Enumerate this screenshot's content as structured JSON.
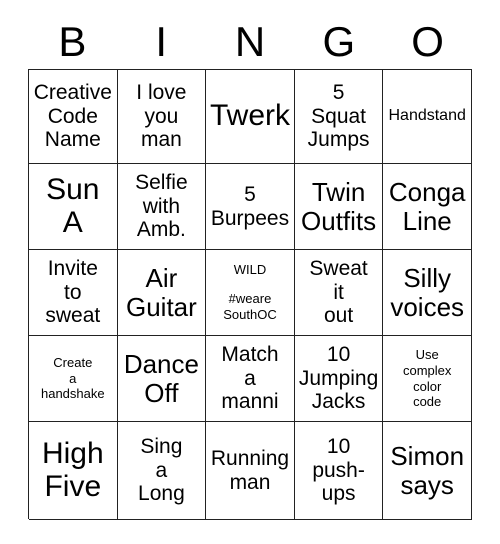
{
  "card": {
    "title_letters": [
      "B",
      "I",
      "N",
      "G",
      "O"
    ],
    "rows": [
      [
        {
          "text": "Creative\nCode\nName",
          "size": "fs-md"
        },
        {
          "text": "I love\nyou\nman",
          "size": "fs-md"
        },
        {
          "text": "Twerk",
          "size": "fs-xl"
        },
        {
          "text": "5\nSquat\nJumps",
          "size": "fs-md"
        },
        {
          "text": "Handstand",
          "size": "fs-sm"
        }
      ],
      [
        {
          "text": "Sun\nA",
          "size": "fs-xl"
        },
        {
          "text": "Selfie\nwith\nAmb.",
          "size": "fs-md"
        },
        {
          "text": "5\nBurpees",
          "size": "fs-md"
        },
        {
          "text": "Twin\nOutfits",
          "size": "fs-lg"
        },
        {
          "text": "Conga\nLine",
          "size": "fs-lg"
        }
      ],
      [
        {
          "text": "Invite\nto\nsweat",
          "size": "fs-md"
        },
        {
          "text": "Air\nGuitar",
          "size": "fs-lg"
        },
        {
          "text": "WILD",
          "tag": "#weare\nSouthOC",
          "size": "wild"
        },
        {
          "text": "Sweat\nit\nout",
          "size": "fs-md"
        },
        {
          "text": "Silly\nvoices",
          "size": "fs-lg"
        }
      ],
      [
        {
          "text": "Create\na\nhandshake",
          "size": "fs-xs"
        },
        {
          "text": "Dance\nOff",
          "size": "fs-lg"
        },
        {
          "text": "Match\na\nmanni",
          "size": "fs-md"
        },
        {
          "text": "10\nJumping\nJacks",
          "size": "fs-md"
        },
        {
          "text": "Use\ncomplex\ncolor\ncode",
          "size": "fs-xs"
        }
      ],
      [
        {
          "text": "High\nFive",
          "size": "fs-xl"
        },
        {
          "text": "Sing\na\nLong",
          "size": "fs-md"
        },
        {
          "text": "Running\nman",
          "size": "fs-md"
        },
        {
          "text": "10\npush-\nups",
          "size": "fs-md"
        },
        {
          "text": "Simon\nsays",
          "size": "fs-lg"
        }
      ]
    ]
  },
  "colors": {
    "grid_line": "#222222",
    "text": "#000000",
    "background": "#ffffff"
  }
}
